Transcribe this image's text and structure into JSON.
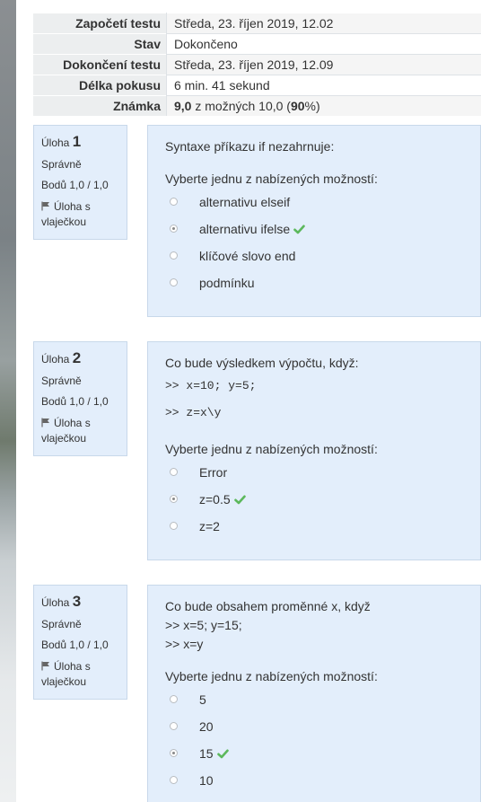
{
  "summary": [
    {
      "label": "Započetí testu",
      "value": "Středa, 23. říjen 2019, 12.02"
    },
    {
      "label": "Stav",
      "value": "Dokončeno"
    },
    {
      "label": "Dokončení testu",
      "value": "Středa, 23. říjen 2019, 12.09"
    },
    {
      "label": "Délka pokusu",
      "value": "6 min. 41 sekund"
    },
    {
      "label": "Známka",
      "grade": "9,0",
      "middle": " z možných 10,0 (",
      "percent": "90",
      "end": "%)"
    }
  ],
  "questions": [
    {
      "title": "Úloha",
      "number": "1",
      "status": "Správně",
      "points": "Bodů 1,0 / 1,0",
      "flag": "Úloha s vlaječkou",
      "text": "Syntaxe příkazu if nezahrnuje:",
      "prompt": "Vyberte jednu z nabízených možností:",
      "options": [
        "alternativu elseif",
        "alternativu ifelse",
        "klíčové slovo end",
        "podmínku"
      ],
      "selected": 1
    },
    {
      "title": "Úloha",
      "number": "2",
      "status": "Správně",
      "points": "Bodů 1,0 / 1,0",
      "flag": "Úloha s vlaječkou",
      "text": "Co bude výsledkem výpočtu, když:",
      "code": [
        ">> x=10; y=5;",
        ">> z=x\\y"
      ],
      "prompt": "Vyberte jednu z nabízených možností:",
      "options": [
        "Error",
        "z=0.5",
        "z=2"
      ],
      "selected": 1
    },
    {
      "title": "Úloha",
      "number": "3",
      "status": "Správně",
      "points": "Bodů 1,0 / 1,0",
      "flag": "Úloha s vlaječkou",
      "text": "Co bude obsahem proměnné x, když",
      "lines": [
        ">> x=5; y=15;",
        ">> x=y"
      ],
      "prompt": "Vyberte jednu z nabízených možností:",
      "options": [
        "5",
        "20",
        "15",
        "10"
      ],
      "selected": 2
    }
  ],
  "colors": {
    "panel": "#e3eefb",
    "check": "#5cb85c"
  },
  "icons": {
    "flag": "flag-icon",
    "correct": "check-icon"
  }
}
